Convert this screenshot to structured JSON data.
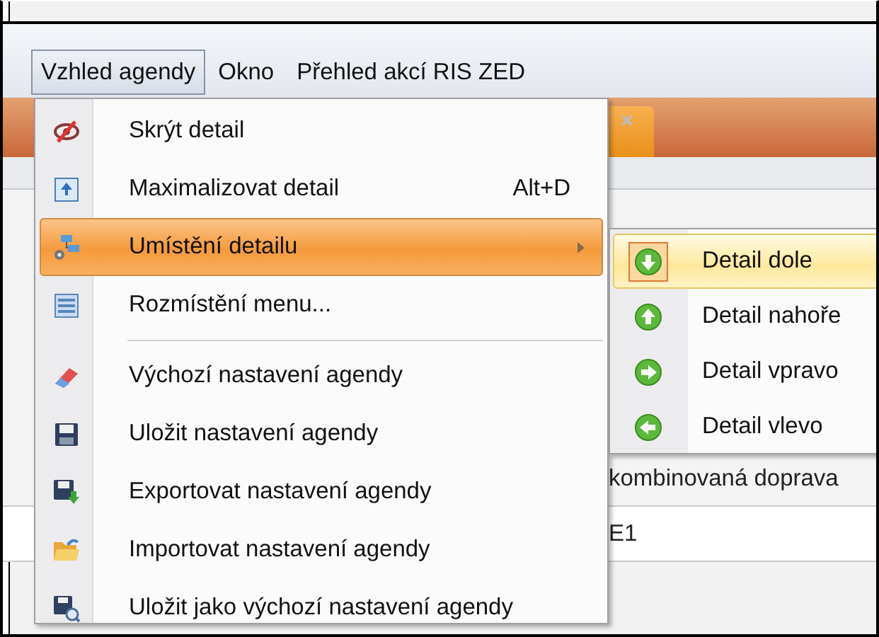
{
  "menubar": [
    {
      "label": "Vzhled agendy",
      "selected": true
    },
    {
      "label": "Okno",
      "selected": false
    },
    {
      "label": "Přehled akcí RIS ZED",
      "selected": false
    }
  ],
  "menu": {
    "items": [
      {
        "kind": "item",
        "label": "Skrýt detail",
        "selected": false
      },
      {
        "kind": "item",
        "label": "Maximalizovat detail",
        "shortcut": "Alt+D",
        "selected": false
      },
      {
        "kind": "submenu",
        "label": "Umístění detailu",
        "selected": true
      },
      {
        "kind": "item",
        "label": "Rozmístění menu...",
        "selected": false
      },
      {
        "kind": "separator"
      },
      {
        "kind": "item",
        "label": "Výchozí nastavení agendy",
        "selected": false
      },
      {
        "kind": "item",
        "label": "Uložit nastavení agendy",
        "selected": false
      },
      {
        "kind": "item",
        "label": "Exportovat nastavení agendy",
        "selected": false
      },
      {
        "kind": "item",
        "label": "Importovat nastavení agendy",
        "selected": false
      },
      {
        "kind": "item",
        "label": "Uložit jako výchozí nastavení agendy",
        "selected": false
      }
    ]
  },
  "submenu": {
    "items": [
      {
        "label": "Detail dole",
        "selected": true
      },
      {
        "label": "Detail nahoře",
        "selected": false
      },
      {
        "label": "Detail vpravo",
        "selected": false
      },
      {
        "label": "Detail vlevo",
        "selected": false
      }
    ]
  },
  "background": {
    "rows": [
      "kombinovaná doprava",
      "E1"
    ]
  }
}
